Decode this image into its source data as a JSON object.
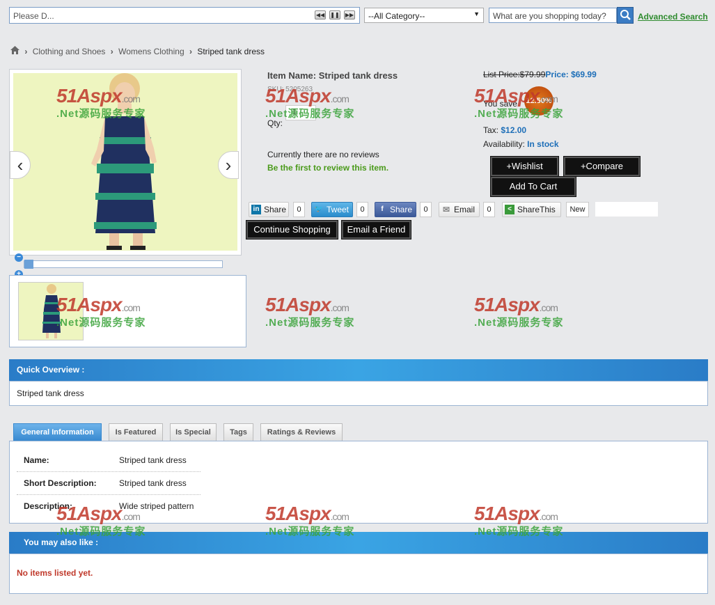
{
  "topbar": {
    "ticker_text": "Please D...",
    "category": "--All Category--",
    "search_placeholder": "What are you shopping today?",
    "advanced_search": "Advanced Search"
  },
  "breadcrumb": {
    "items": [
      "Clothing and Shoes",
      "Womens Clothing"
    ],
    "current": "Striped tank dress"
  },
  "product": {
    "item_name_label": "Item Name:",
    "item_name": "Striped tank dress",
    "sku": "SKU: 5205263",
    "qty_label": "Qty:",
    "qty_value": "1",
    "reviews_text": "Currently there are no reviews",
    "first_review": "Be the first to review this item.",
    "list_price": "List Price:$79.99",
    "price_label": "Price: $69.99",
    "you_save": "You save",
    "save_badge": "12.50%",
    "tax_label": "Tax:",
    "tax_value": "$12.00",
    "availability_label": "Availability:",
    "availability_value": "In stock"
  },
  "buttons": {
    "wishlist": "+Wishlist",
    "compare": "+Compare",
    "add_to_cart": "Add To Cart",
    "continue_shopping": "Continue Shopping",
    "email_friend": "Email a Friend"
  },
  "social": {
    "linkedin": "Share",
    "linkedin_count": "0",
    "tweet": "Tweet",
    "tweet_count": "0",
    "facebook": "Share",
    "facebook_count": "0",
    "email": "Email",
    "email_count": "0",
    "sharethis": "ShareThis",
    "new": "New"
  },
  "quick_overview": {
    "title": "Quick Overview :",
    "text": "Striped tank dress"
  },
  "tabs": [
    "General Information",
    "Is Featured",
    "Is Special",
    "Tags",
    "Ratings & Reviews"
  ],
  "general_info": [
    {
      "label": "Name:",
      "value": "Striped tank dress"
    },
    {
      "label": "Short Description:",
      "value": "Striped tank dress"
    },
    {
      "label": "Description:",
      "value": "Wide striped pattern"
    }
  ],
  "also_like": {
    "title": "You may also like :",
    "empty": "No items listed yet."
  },
  "watermark": {
    "brand": "51Aspx",
    "brand_suffix": ".com",
    "tagline": ".Net源码服务专家"
  },
  "colors": {
    "accent_blue": "#2a7cc7",
    "price_blue": "#1e6fb8",
    "review_green": "#4a9a1a",
    "empty_red": "#c0392b"
  }
}
